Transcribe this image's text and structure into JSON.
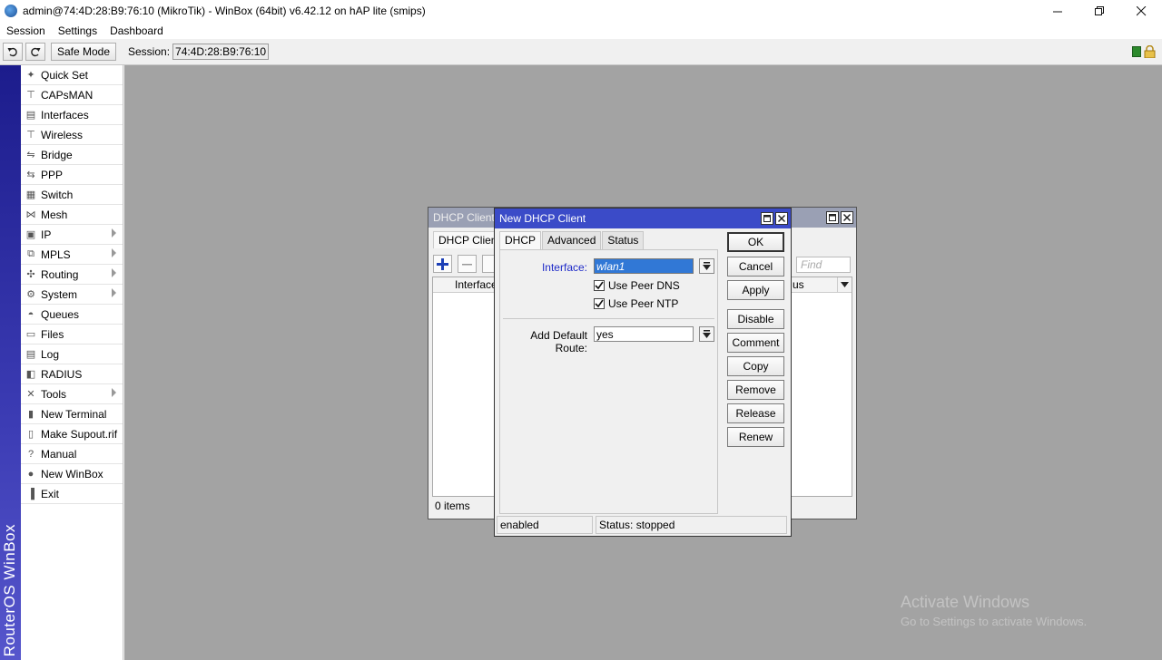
{
  "window": {
    "title": "admin@74:4D:28:B9:76:10 (MikroTik) - WinBox (64bit) v6.42.12 on hAP lite (smips)"
  },
  "menu": [
    "Session",
    "Settings",
    "Dashboard"
  ],
  "toolbar": {
    "safe_mode": "Safe Mode",
    "session_label": "Session:",
    "session_value": "74:4D:28:B9:76:10"
  },
  "brand": "RouterOS WinBox",
  "sidebar": {
    "items": [
      {
        "label": "Quick Set",
        "icon": "magic-wand-icon",
        "submenu": false
      },
      {
        "label": "CAPsMAN",
        "icon": "antenna-icon",
        "submenu": false
      },
      {
        "label": "Interfaces",
        "icon": "network-card-icon",
        "submenu": false
      },
      {
        "label": "Wireless",
        "icon": "antenna-icon",
        "submenu": false
      },
      {
        "label": "Bridge",
        "icon": "bridge-icon",
        "submenu": false
      },
      {
        "label": "PPP",
        "icon": "ppp-icon",
        "submenu": false
      },
      {
        "label": "Switch",
        "icon": "switch-icon",
        "submenu": false
      },
      {
        "label": "Mesh",
        "icon": "mesh-icon",
        "submenu": false
      },
      {
        "label": "IP",
        "icon": "ip-icon",
        "submenu": true
      },
      {
        "label": "MPLS",
        "icon": "mpls-icon",
        "submenu": true
      },
      {
        "label": "Routing",
        "icon": "routing-icon",
        "submenu": true
      },
      {
        "label": "System",
        "icon": "gear-icon",
        "submenu": true
      },
      {
        "label": "Queues",
        "icon": "queues-icon",
        "submenu": false
      },
      {
        "label": "Files",
        "icon": "folder-icon",
        "submenu": false
      },
      {
        "label": "Log",
        "icon": "log-icon",
        "submenu": false
      },
      {
        "label": "RADIUS",
        "icon": "radius-icon",
        "submenu": false
      },
      {
        "label": "Tools",
        "icon": "tools-icon",
        "submenu": true
      },
      {
        "label": "New Terminal",
        "icon": "terminal-icon",
        "submenu": false
      },
      {
        "label": "Make Supout.rif",
        "icon": "document-icon",
        "submenu": false
      },
      {
        "label": "Manual",
        "icon": "help-icon",
        "submenu": false
      },
      {
        "label": "New WinBox",
        "icon": "winbox-icon",
        "submenu": false
      },
      {
        "label": "Exit",
        "icon": "exit-icon",
        "submenu": false
      }
    ]
  },
  "dhcp_window": {
    "title": "DHCP Client",
    "tab": "DHCP Client",
    "find_placeholder": "Find",
    "column_interface": "Interface",
    "column_status_partial": "us",
    "item_count": "0 items"
  },
  "dialog": {
    "title": "New DHCP Client",
    "tabs": [
      "DHCP",
      "Advanced",
      "Status"
    ],
    "interface_label": "Interface:",
    "interface_value": "wlan1",
    "use_peer_dns": "Use Peer DNS",
    "use_peer_ntp": "Use Peer NTP",
    "default_route_label": "Add Default Route:",
    "default_route_value": "yes",
    "buttons": [
      "OK",
      "Cancel",
      "Apply",
      "Disable",
      "Comment",
      "Copy",
      "Remove",
      "Release",
      "Renew"
    ],
    "status_enabled": "enabled",
    "status_text": "Status: stopped"
  },
  "watermark": {
    "line1": "Activate Windows",
    "line2": "Go to Settings to activate Windows."
  },
  "colors": {
    "dialog_title": "#3b4bc8",
    "inactive_title": "#9aa0b4",
    "selection": "#3178d6",
    "workspace": "#a3a3a3",
    "interface_label": "#1e2ac8"
  }
}
